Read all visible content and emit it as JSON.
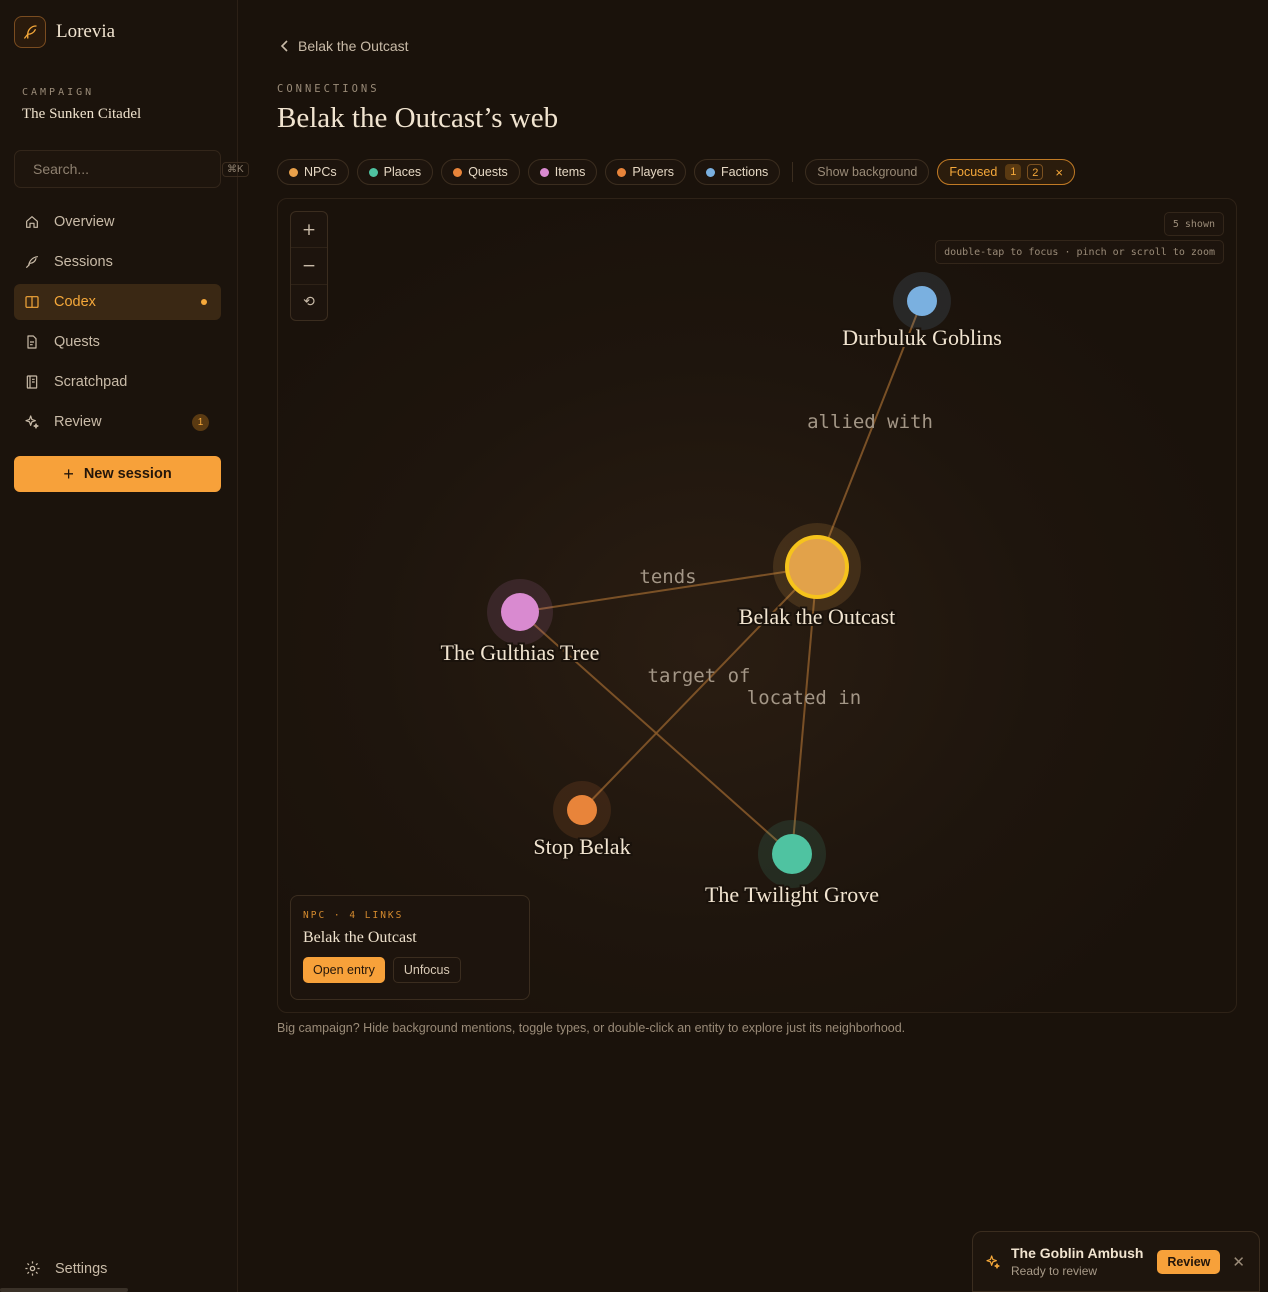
{
  "brand": {
    "name": "Lorevia"
  },
  "campaign": {
    "label": "CAMPAIGN",
    "name": "The Sunken Citadel"
  },
  "search": {
    "placeholder": "Search...",
    "shortcut": "⌘K"
  },
  "nav": {
    "items": [
      {
        "label": "Overview",
        "icon": "home-icon"
      },
      {
        "label": "Sessions",
        "icon": "feather-icon"
      },
      {
        "label": "Codex",
        "icon": "book-icon",
        "active": true
      },
      {
        "label": "Quests",
        "icon": "document-icon"
      },
      {
        "label": "Scratchpad",
        "icon": "notebook-icon"
      },
      {
        "label": "Review",
        "icon": "sparkle-icon",
        "badge": "1"
      }
    ],
    "new_session": "New session",
    "settings": "Settings"
  },
  "header": {
    "back_label": "Belak the Outcast",
    "section_label": "CONNECTIONS",
    "title": "Belak the Outcast’s web"
  },
  "filters": {
    "types": [
      {
        "label": "NPCs",
        "color": "#e8a04a"
      },
      {
        "label": "Places",
        "color": "#4fc3a1"
      },
      {
        "label": "Quests",
        "color": "#e8843a"
      },
      {
        "label": "Items",
        "color": "#d98ad0"
      },
      {
        "label": "Players",
        "color": "#e8843a"
      },
      {
        "label": "Factions",
        "color": "#7ab0e0"
      }
    ],
    "show_background": "Show background",
    "focused_label": "Focused",
    "focused_levels": [
      "1",
      "2"
    ],
    "clear": "×"
  },
  "graph": {
    "shown": "5 shown",
    "hint": "double-tap to focus · pinch or scroll to zoom",
    "zoom_in": "+",
    "zoom_out": "−",
    "reset": "⟲",
    "accent": "#f5a83a",
    "edge_color": "#8a5a2a",
    "nodes": [
      {
        "id": "belak",
        "label": "Belak the Outcast",
        "color": "#e2a24a",
        "focus": true
      },
      {
        "id": "goblins",
        "label": "Durbuluk Goblins",
        "color": "#7ab0e0"
      },
      {
        "id": "tree",
        "label": "The Gulthias Tree",
        "color": "#d98ad0"
      },
      {
        "id": "stop",
        "label": "Stop Belak",
        "color": "#e8843a"
      },
      {
        "id": "grove",
        "label": "The Twilight Grove",
        "color": "#4fc3a1"
      }
    ],
    "edges": [
      {
        "from": "belak",
        "to": "goblins",
        "label": "allied with"
      },
      {
        "from": "belak",
        "to": "tree",
        "label": "tends"
      },
      {
        "from": "belak",
        "to": "stop",
        "label": "target of"
      },
      {
        "from": "belak",
        "to": "grove",
        "label": "located in"
      },
      {
        "from": "tree",
        "to": "grove",
        "label": ""
      }
    ]
  },
  "info_card": {
    "meta": "NPC · 4 LINKS",
    "name": "Belak the Outcast",
    "open": "Open entry",
    "unfocus": "Unfocus"
  },
  "footnote": "Big campaign? Hide background mentions, toggle types, or double-click an entity to explore just its neighborhood.",
  "toast": {
    "title": "The Goblin Ambush",
    "subtitle": "Ready to review",
    "action": "Review",
    "close": "✕"
  }
}
